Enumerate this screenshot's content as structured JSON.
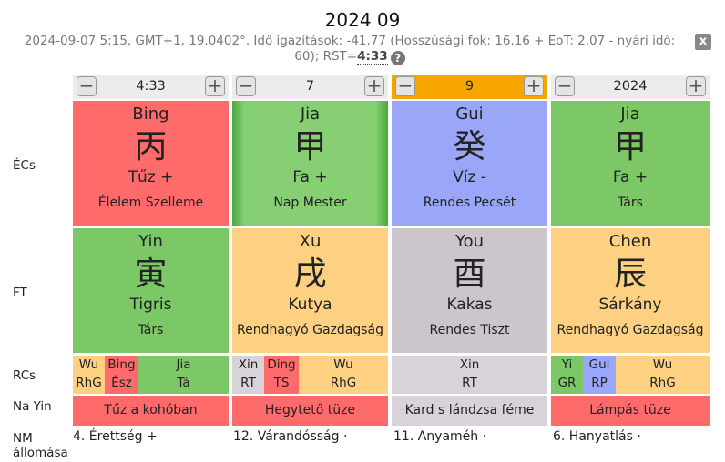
{
  "header": {
    "title": "2024 09",
    "subtitle_prefix": "2024-09-07 5:15, GMT+1, 19.0402°. Idő igazítások: -41.77 (Hosszúsági fok: 16.16 + EoT: 2.07 - nyári idő: 60); RST=",
    "rst": "4:33",
    "help_glyph": "?",
    "close_glyph": "x"
  },
  "row_labels": {
    "ecs": "ÉCs",
    "ft": "FT",
    "rcs": "RCs",
    "nayin": "Na Yin",
    "nm": "NM állomása"
  },
  "steppers": [
    {
      "value": "4:33",
      "active": false
    },
    {
      "value": "7",
      "active": false
    },
    {
      "value": "9",
      "active": true
    },
    {
      "value": "2024",
      "active": false
    }
  ],
  "stepper_minus": "−",
  "stepper_plus": "+",
  "stems": [
    {
      "pinyin": "Bing",
      "hanzi": "丙",
      "element": "Tűz +",
      "role": "Élelem Szelleme",
      "color": "#ff6b6b"
    },
    {
      "pinyin": "Jia",
      "hanzi": "甲",
      "element": "Fa +",
      "role": "Nap Mester",
      "color": "#7dc866"
    },
    {
      "pinyin": "Gui",
      "hanzi": "癸",
      "element": "Víz -",
      "role": "Rendes Pecsét",
      "color": "#9aa6f7"
    },
    {
      "pinyin": "Jia",
      "hanzi": "甲",
      "element": "Fa +",
      "role": "Társ",
      "color": "#7dc866"
    }
  ],
  "branches": [
    {
      "pinyin": "Yin",
      "hanzi": "寅",
      "animal": "Tigris",
      "role": "Társ",
      "color": "#7dc866"
    },
    {
      "pinyin": "Xu",
      "hanzi": "戌",
      "animal": "Kutya",
      "role": "Rendhagyó Gazdagság",
      "color": "#fdd082"
    },
    {
      "pinyin": "You",
      "hanzi": "酉",
      "animal": "Kakas",
      "role": "Rendes Tiszt",
      "color": "#cbc6cb"
    },
    {
      "pinyin": "Chen",
      "hanzi": "辰",
      "animal": "Sárkány",
      "role": "Rendhagyó Gazdagság",
      "color": "#fdd082"
    }
  ],
  "hidden_stems": [
    [
      {
        "stem": "Wu",
        "role": "RhG"
      },
      {
        "stem": "Bing",
        "role": "Ész"
      },
      {
        "stem": "Jia",
        "role": "Tá"
      }
    ],
    [
      {
        "stem": "Xin",
        "role": "RT"
      },
      {
        "stem": "Ding",
        "role": "TS"
      },
      {
        "stem": "Wu",
        "role": "RhG"
      }
    ],
    [
      {
        "stem": "Xin",
        "role": "RT"
      }
    ],
    [
      {
        "stem": "Yi",
        "role": "GR"
      },
      {
        "stem": "Gui",
        "role": "RP"
      },
      {
        "stem": "Wu",
        "role": "RhG"
      }
    ]
  ],
  "nayin": [
    {
      "text": "Tűz a kohóban"
    },
    {
      "text": "Hegytető tüze"
    },
    {
      "text": "Kard s lándzsa féme"
    },
    {
      "text": "Lámpás tüze"
    }
  ],
  "nm": [
    "4. Érettség +",
    "12. Várandósság ·",
    "11. Anyaméh ·",
    "6. Hanyatlás ·"
  ]
}
